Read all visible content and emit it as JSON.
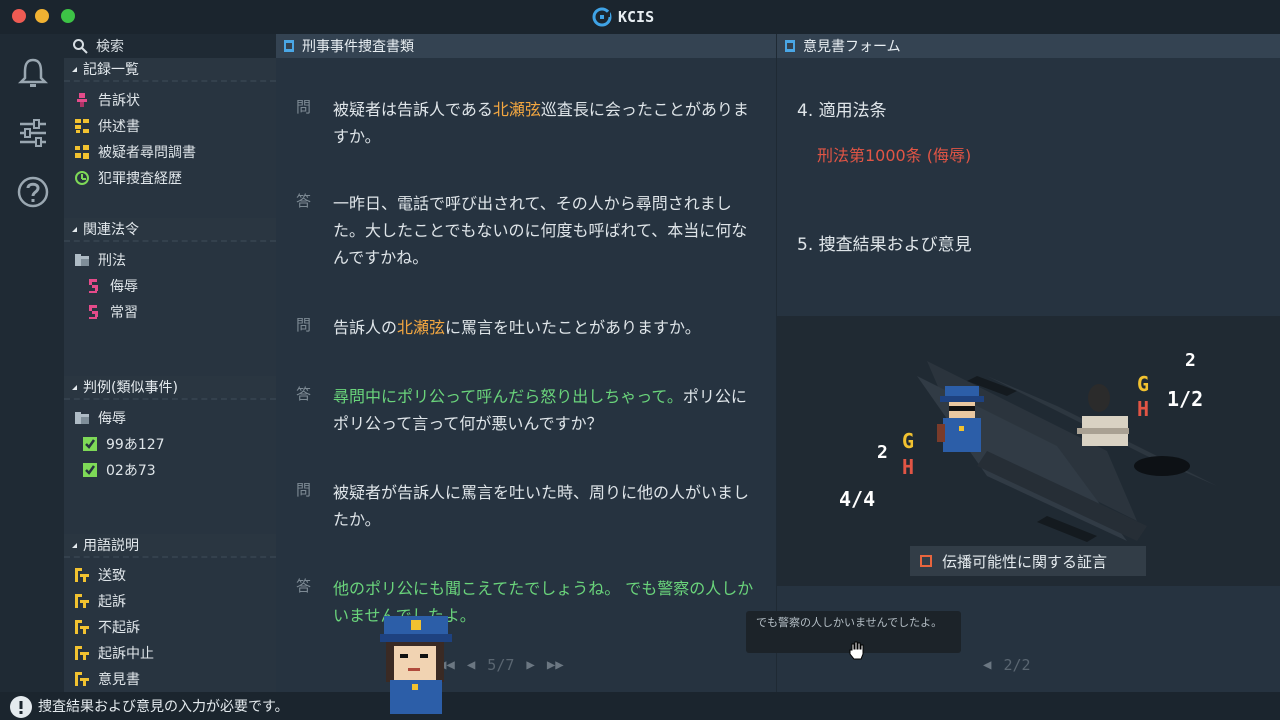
{
  "app": {
    "title": "KCIS"
  },
  "search": {
    "label": "検索"
  },
  "sections": {
    "records": {
      "title": "記録一覧",
      "items": [
        {
          "label": "告訴状",
          "icon": "complaint-icon",
          "color": "#e54b8a"
        },
        {
          "label": "供述書",
          "icon": "statement-icon",
          "color": "#f2c230"
        },
        {
          "label": "被疑者尋問調書",
          "icon": "interrogation-icon",
          "color": "#f2c230"
        },
        {
          "label": "犯罪捜査経歴",
          "icon": "history-icon",
          "color": "#7ed957"
        }
      ]
    },
    "laws": {
      "title": "関連法令",
      "folder": "刑法",
      "items": [
        {
          "label": "侮辱",
          "icon": "law-icon"
        },
        {
          "label": "常習",
          "icon": "law-icon"
        }
      ]
    },
    "precedents": {
      "title": "判例(類似事件)",
      "folder": "侮辱",
      "items": [
        {
          "label": "99あ127",
          "icon": "checked-icon"
        },
        {
          "label": "02あ73",
          "icon": "checked-icon"
        }
      ]
    },
    "glossary": {
      "title": "用語説明",
      "items": [
        {
          "label": "送致",
          "icon": "term-icon"
        },
        {
          "label": "起訴",
          "icon": "term-icon"
        },
        {
          "label": "不起訴",
          "icon": "term-icon"
        },
        {
          "label": "起訴中止",
          "icon": "term-icon"
        },
        {
          "label": "意見書",
          "icon": "term-icon"
        }
      ]
    }
  },
  "left_panel": {
    "title": "刑事事件捜査書類",
    "qa": [
      {
        "kind": "問",
        "parts": [
          {
            "t": "被疑者は告訴人である"
          },
          {
            "t": "北瀬弦",
            "c": "orange"
          },
          {
            "t": "巡査長に会ったことがありますか。"
          }
        ]
      },
      {
        "kind": "答",
        "parts": [
          {
            "t": "一昨日、電話で呼び出されて、その人から尋問されました。大したことでもないのに何度も呼ばれて、本当に何なんですかね。"
          }
        ]
      },
      {
        "kind": "問",
        "parts": [
          {
            "t": "告訴人の"
          },
          {
            "t": "北瀬弦",
            "c": "orange"
          },
          {
            "t": "に罵言を吐いたことがありますか。"
          }
        ]
      },
      {
        "kind": "答",
        "parts": [
          {
            "t": "尋問中にポリ公って呼んだら怒り出しちゃって。",
            "c": "green"
          },
          {
            "t": "ポリ公にポリ公って言って何が悪いんですか？"
          }
        ]
      },
      {
        "kind": "問",
        "parts": [
          {
            "t": "被疑者が告訴人に罵言を吐いた時、周りに他の人がいましたか。"
          }
        ]
      },
      {
        "kind": "答",
        "parts": [
          {
            "t": "他のポリ公にも聞こえてたでしょうね。 でも警察の人しかいませんでしたよ。",
            "c": "green"
          }
        ]
      }
    ],
    "pager": {
      "current": "5",
      "total": "7",
      "display": "5/7"
    }
  },
  "right_panel": {
    "title": "意見書フォーム",
    "section4_label": "4. 適用法条",
    "section4_value": "刑法第1000条 (侮辱)",
    "section5_label": "5. 捜査結果および意見",
    "scene": {
      "left_stats": {
        "g": "G",
        "h": "H",
        "top": "2",
        "fraction": "4/4"
      },
      "right_stats": {
        "g": "G",
        "h": "H",
        "top": "2",
        "fraction": "1/2"
      }
    },
    "testimony_tag": "伝播可能性に関する証言",
    "tooltip": "でも警察の人しかいませんでしたよ。",
    "pager": {
      "display": "2/2"
    }
  },
  "status": {
    "text": "捜査結果および意見の入力が必要です。"
  },
  "colors": {
    "orange": "#f3a740",
    "green": "#6ad47b",
    "red": "#e15545",
    "accent": "#4aa7e6"
  }
}
